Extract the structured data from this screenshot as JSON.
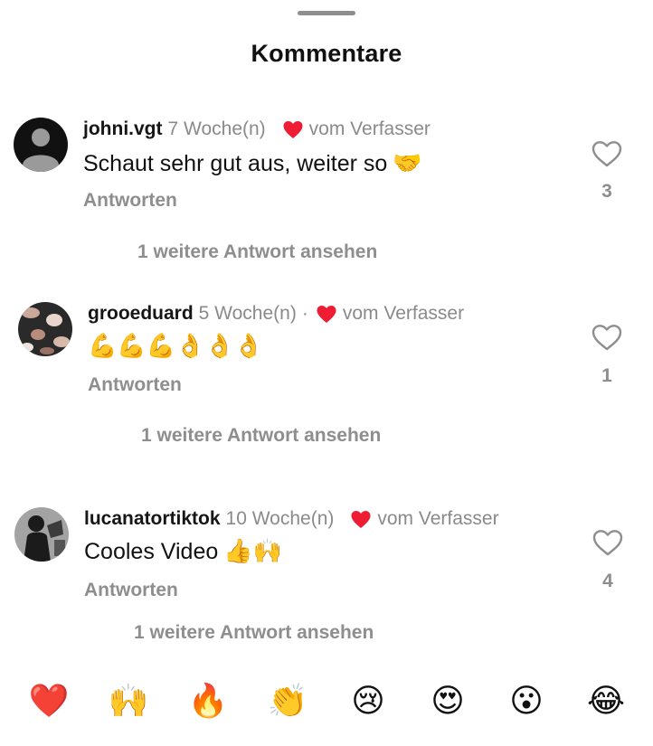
{
  "header": {
    "title": "Kommentare"
  },
  "comments": [
    {
      "username": "johni.vgt",
      "time": "7 Woche(n)",
      "author_badge": "vom Verfasser",
      "text": "Schaut sehr gut aus, weiter so",
      "emoji": "🤝",
      "reply_label": "Antworten",
      "more_replies": "1 weitere Antwort ansehen",
      "likes": "3"
    },
    {
      "username": "grooeduard",
      "time": "5 Woche(n)",
      "separator": "·",
      "author_badge": "vom Verfasser",
      "text": "",
      "emoji": "💪💪💪👌👌👌",
      "reply_label": "Antworten",
      "more_replies": "1 weitere Antwort ansehen",
      "likes": "1"
    },
    {
      "username": "lucanatortiktok",
      "time": "10 Woche(n)",
      "author_badge": "vom Verfasser",
      "text": "Cooles Video",
      "emoji": "👍🙌",
      "reply_label": "Antworten",
      "more_replies": "1 weitere Antwort ansehen",
      "likes": "4"
    }
  ],
  "emoji_bar": [
    "❤️",
    "🙌",
    "🔥",
    "👏",
    "😢",
    "😍",
    "😮",
    "😂"
  ],
  "colors": {
    "heart_red": "#ee1d34",
    "muted": "#8a8a8a",
    "text": "#111111"
  }
}
